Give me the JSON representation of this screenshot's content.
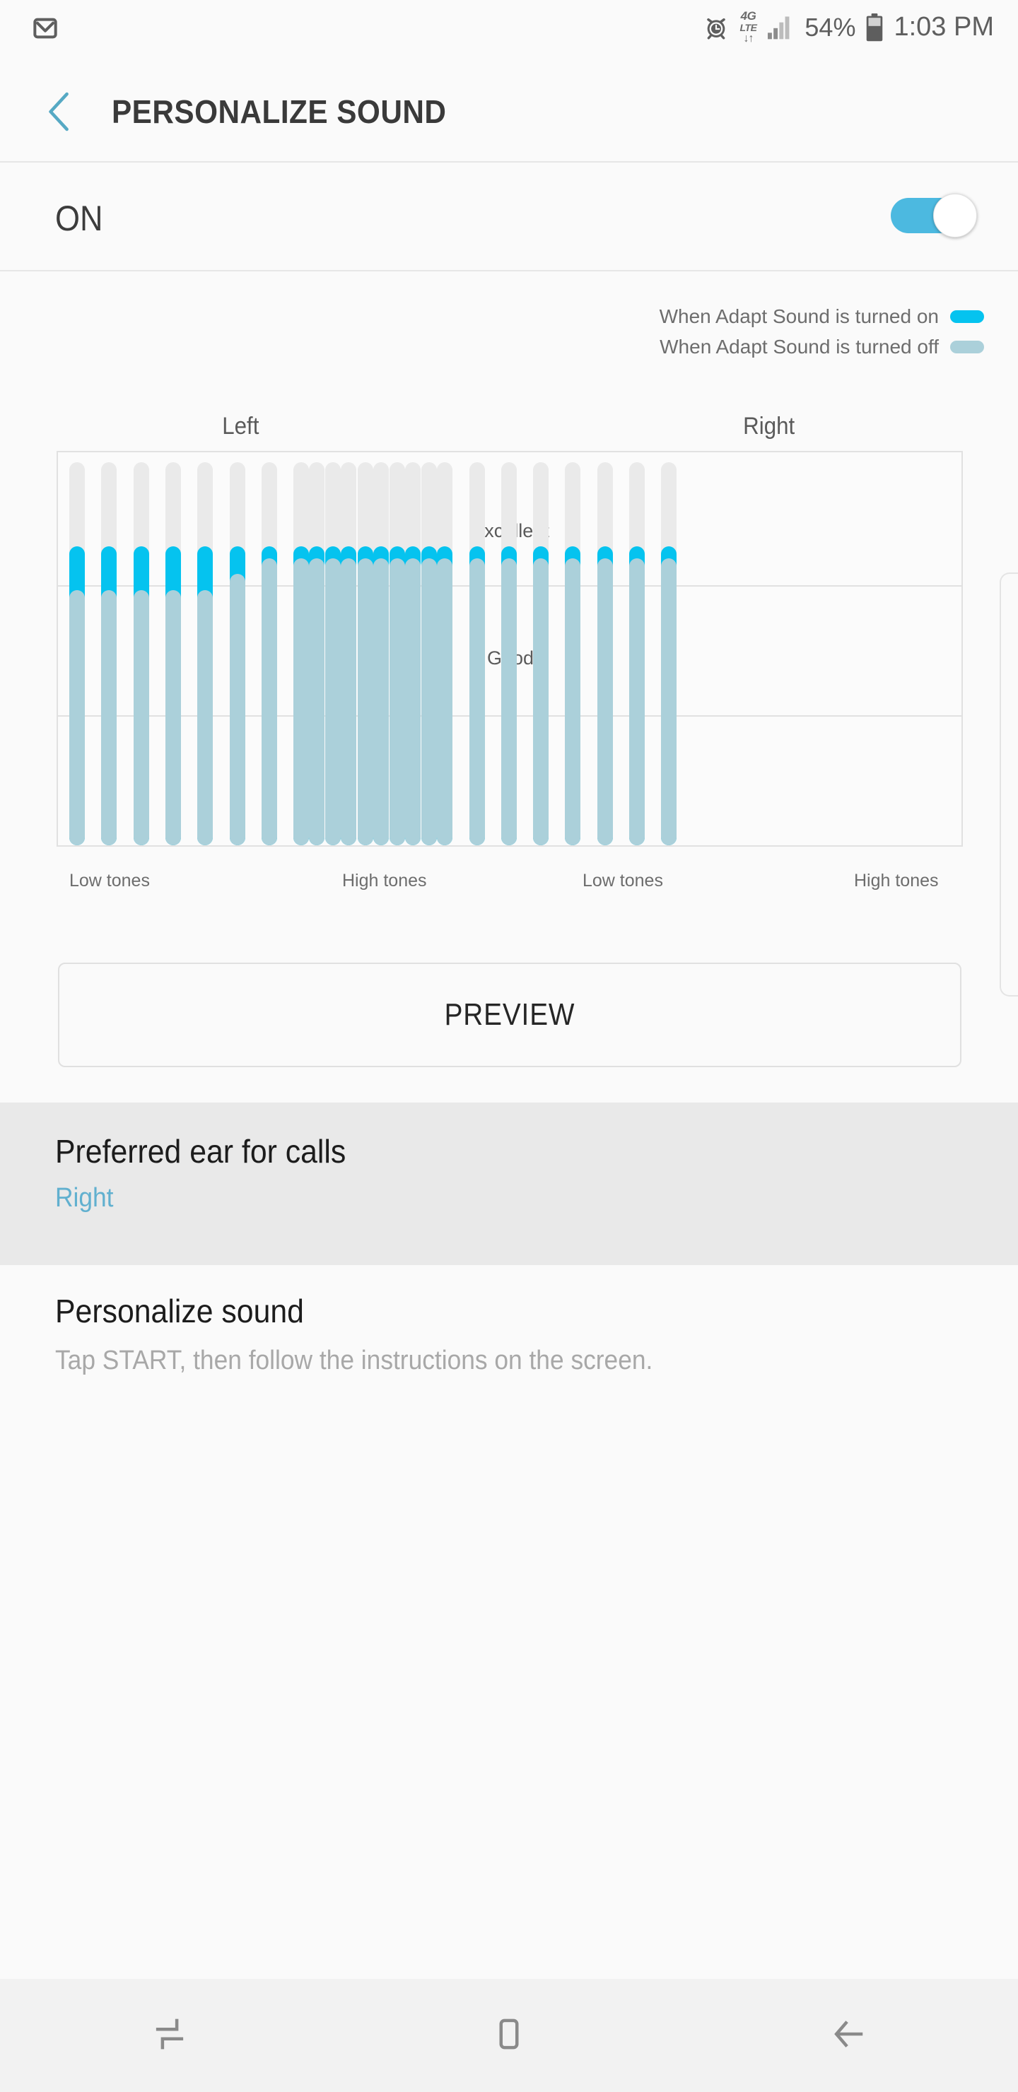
{
  "status_bar": {
    "notification_icon": "gmail-icon",
    "alarm_icon": "alarm-clock-icon",
    "network_label_top": "4G",
    "network_label_bottom": "LTE",
    "network_arrows": "↓↑",
    "signal_icon": "signal-bars-icon",
    "battery_percent": "54%",
    "battery_icon": "battery-icon",
    "time": "1:03 PM"
  },
  "title_bar": {
    "back_icon": "back-chevron-icon",
    "title": "PERSONALIZE SOUND",
    "back_icon_color": "#56a9c4"
  },
  "toggle_row": {
    "label": "ON",
    "state": "on",
    "accent_color": "#4cb9e0"
  },
  "legend": {
    "items": [
      {
        "label": "When Adapt Sound is turned on",
        "color": "#05c3ef"
      },
      {
        "label": "When Adapt Sound is turned off",
        "color": "#abd0da"
      }
    ]
  },
  "chart_data": {
    "type": "bar",
    "title": "",
    "channel_labels": [
      "Left",
      "Right"
    ],
    "zone_labels": [
      "Excellent",
      "Good"
    ],
    "tone_labels": [
      "Low tones",
      "High tones",
      "Low tones",
      "High tones"
    ],
    "ylabel": "",
    "xlabel": "",
    "grid": true,
    "legend_position": "top-right",
    "bars_per_channel": 12,
    "value_scale_max": 100,
    "series": [
      {
        "name": "When Adapt Sound is turned on",
        "color": "#05c3ef",
        "left": [
          76,
          76,
          76,
          76,
          76,
          76,
          76,
          76,
          76,
          76,
          76,
          76
        ],
        "right": [
          76,
          76,
          76,
          76,
          76,
          76,
          76,
          76,
          76,
          76,
          76,
          76
        ]
      },
      {
        "name": "When Adapt Sound is turned off",
        "color": "#abd0da",
        "left": [
          65,
          65,
          65,
          65,
          65,
          69,
          73,
          73,
          73,
          73,
          73,
          73
        ],
        "right": [
          73,
          73,
          73,
          73,
          73,
          73,
          73,
          73,
          73,
          73,
          73,
          73
        ]
      }
    ],
    "track_color": "#eaeaea",
    "frame_color": "#e1e1e1"
  },
  "preview_button": {
    "label": "PREVIEW"
  },
  "preferred_ear": {
    "title": "Preferred ear for calls",
    "value": "Right",
    "value_color": "#61b0cf"
  },
  "personalize_sound": {
    "title": "Personalize sound",
    "subtitle": "Tap START, then follow the instructions on the screen."
  },
  "nav_bar": {
    "recents_icon": "recents-icon",
    "home_icon": "home-icon",
    "back_icon": "back-arrow-icon"
  }
}
